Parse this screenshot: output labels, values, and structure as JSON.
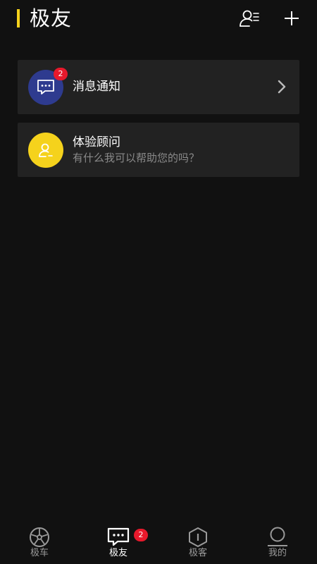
{
  "header": {
    "title": "极友",
    "accent_color": "#f5d21c",
    "actions": [
      {
        "icon": "contacts-list-icon"
      },
      {
        "icon": "plus-icon"
      }
    ]
  },
  "cards": {
    "notifications": {
      "title": "消息通知",
      "badge": "2",
      "icon": "chat-bubble-icon",
      "avatar_color": "#2e3b8f"
    },
    "advisor": {
      "title": "体验顾问",
      "subtitle": "有什么我可以帮助您的吗？",
      "icon": "person-icon",
      "avatar_color": "#f5d21c"
    }
  },
  "nav": {
    "active": "极友",
    "items": [
      {
        "label": "极车",
        "icon": "wheel-icon"
      },
      {
        "label": "极友",
        "icon": "chat-bubble-icon",
        "badge": "2"
      },
      {
        "label": "极客",
        "icon": "hexagon-icon"
      },
      {
        "label": "我的",
        "icon": "profile-icon"
      }
    ]
  },
  "badge_color": "#e8192c"
}
